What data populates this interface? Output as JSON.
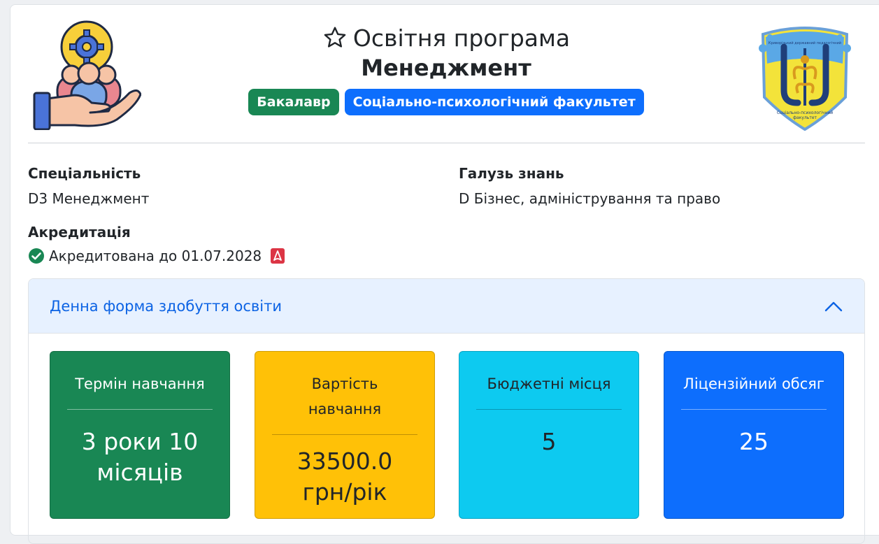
{
  "header": {
    "program_label": "Освітня програма",
    "program_name": "Менеджмент",
    "badges": [
      {
        "label": "Бакалавр",
        "color": "#198754"
      },
      {
        "label": "Соціально-психологічний факультет",
        "color": "#0d6efd"
      }
    ],
    "icons": {
      "favorite": "star-outline-icon",
      "illustration": "people-gear-hand-icon",
      "logo": "university-crest-logo"
    }
  },
  "fields": {
    "specialty_label": "Спеціальність",
    "specialty_value": "D3 Менеджмент",
    "field_label": "Галузь знань",
    "field_value": "D Бізнес, адміністрування та право",
    "accreditation_label": "Акредитація",
    "accreditation_value": "Акредитована до 01.07.2028"
  },
  "accordion": {
    "title": "Денна форма здобуття освіти",
    "expanded": true,
    "stats": [
      {
        "title": "Термін навчання",
        "value": "3 роки 10 місяців",
        "color": "#198754"
      },
      {
        "title": "Вартість навчання",
        "value": "33500.0 грн/рік",
        "color": "#ffc107"
      },
      {
        "title": "Бюджетні місця",
        "value": "5",
        "color": "#0dcaf0"
      },
      {
        "title": "Ліцензійний обсяг",
        "value": "25",
        "color": "#0d6efd"
      }
    ]
  },
  "logo_text": {
    "top": "Криворізький державний педагогічний університет",
    "bottom": "Соціально-психологічний факультет"
  }
}
